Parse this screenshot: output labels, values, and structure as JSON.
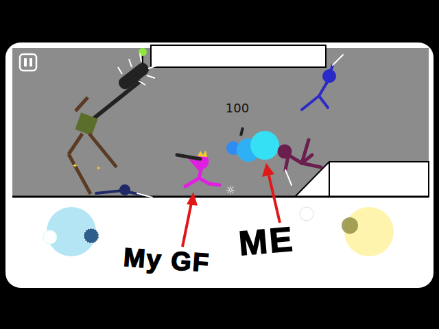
{
  "hud": {
    "score": "100"
  },
  "fighters": [
    {
      "name": "my-gf",
      "color": "#e020e0"
    },
    {
      "name": "me",
      "color": "#6b1f4f"
    },
    {
      "name": "flying",
      "color": "#2a2ac8"
    },
    {
      "name": "fallen",
      "color": "#1f2a66"
    },
    {
      "name": "mace-bot",
      "color": "#5b6f2b"
    }
  ],
  "annotations": [
    {
      "label": "My GF"
    },
    {
      "label": "ME"
    }
  ],
  "joysticks": [
    {
      "color": "#b4e5f5",
      "knob": "#2d5f8c"
    },
    {
      "color": "#fff4ad",
      "knob": "#8c8a3c"
    }
  ]
}
